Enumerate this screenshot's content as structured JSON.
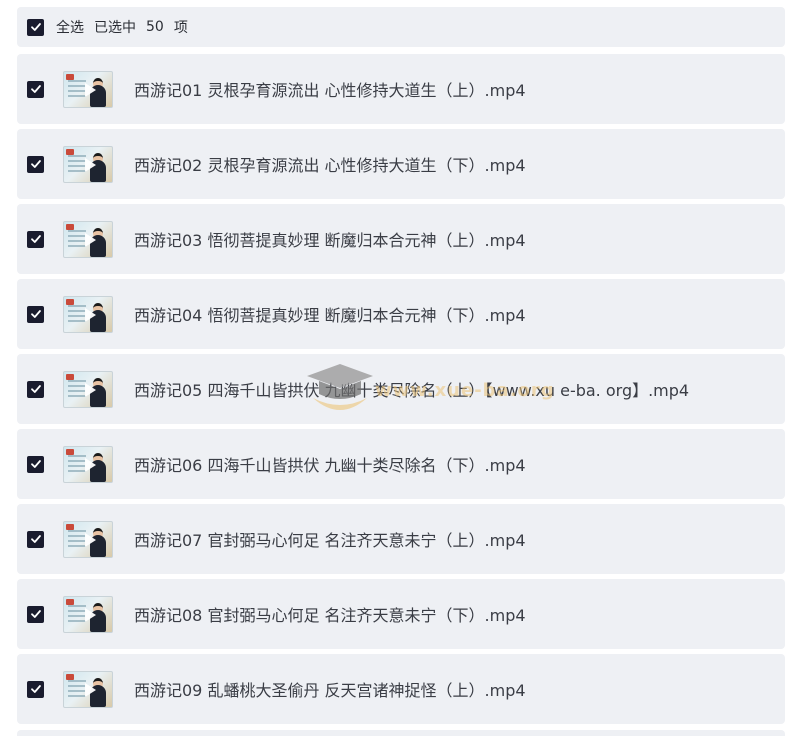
{
  "header": {
    "select_all_label": "全选",
    "selected_label": "已选中",
    "selected_count": "50",
    "unit_label": "项"
  },
  "files": [
    {
      "name": "西游记01 灵根孕育源流出 心性修持大道生（上）.mp4",
      "checked": true
    },
    {
      "name": "西游记02 灵根孕育源流出 心性修持大道生（下）.mp4",
      "checked": true
    },
    {
      "name": "西游记03 悟彻菩提真妙理 断魔归本合元神（上）.mp4",
      "checked": true
    },
    {
      "name": "西游记04 悟彻菩提真妙理 断魔归本合元神（下）.mp4",
      "checked": true
    },
    {
      "name": "西游记05 四海千山皆拱伏 九幽十类尽除名（上）【www.xu e-ba. org】.mp4",
      "checked": true
    },
    {
      "name": "西游记06 四海千山皆拱伏 九幽十类尽除名（下）.mp4",
      "checked": true
    },
    {
      "name": "西游记07 官封弼马心何足 名注齐天意未宁（上）.mp4",
      "checked": true
    },
    {
      "name": "西游记08 官封弼马心何足 名注齐天意未宁（下）.mp4",
      "checked": true
    },
    {
      "name": "西游记09 乱蟠桃大圣偷丹 反天宫诸神捉怪（上）.mp4",
      "checked": true
    }
  ],
  "watermark": {
    "text": "www.xue-ba.org",
    "icon": "graduation-cap-icon"
  },
  "colors": {
    "checkbox": "#1a1c2e",
    "row_bg": "#eef0f4",
    "text": "#3a3d45"
  }
}
